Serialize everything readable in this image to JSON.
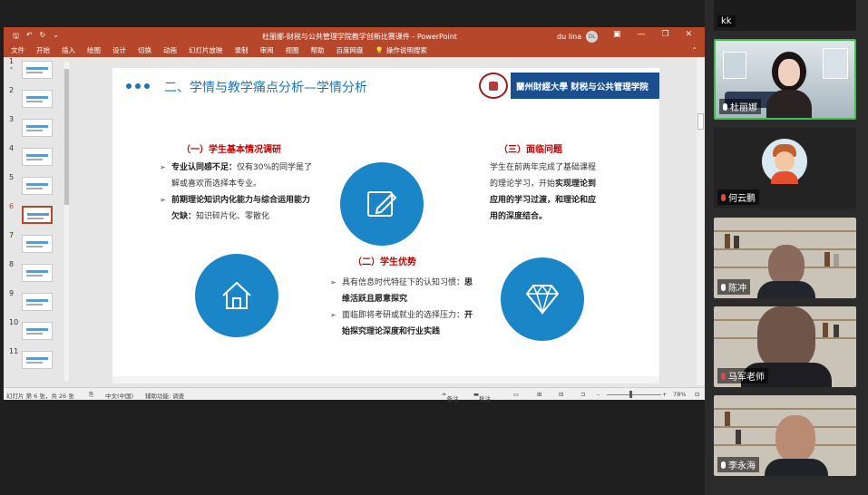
{
  "powerpoint": {
    "window_title": "杜丽娜-财税与公共管理学院教学创新比赛课件 - PowerPoint",
    "user_name": "du lina",
    "user_initials": "DL",
    "ribbon_tabs": [
      "文件",
      "开始",
      "插入",
      "绘图",
      "设计",
      "切换",
      "动画",
      "幻灯片放映",
      "录制",
      "审阅",
      "视图",
      "帮助",
      "百度网盘"
    ],
    "tell_me": "操作说明搜索",
    "thumbnails": [
      "1",
      "2",
      "3",
      "4",
      "5",
      "6",
      "7",
      "8",
      "9",
      "10",
      "11"
    ],
    "selected_slide": 6,
    "status": {
      "slide_info": "幻灯片 第 6 张，共 26 张",
      "language": "中文(中国)",
      "accessibility": "辅助功能: 调查",
      "notes": "备注",
      "comments": "批注",
      "zoom": "78%"
    }
  },
  "slide": {
    "title": "二、学情与教学痛点分析—学情分析",
    "logo_text": "蘭州財經大學 财税与公共管理学院",
    "section1": {
      "heading": "（一）学生基本情况调研",
      "b1_bold": "专业认同感不足：",
      "b1_rest": "仅有30%的同学是了解或喜欢而选择本专业。",
      "b2_bold": "前期理论知识内化能力与综合运用能力欠缺：",
      "b2_rest": "知识碎片化、零散化"
    },
    "section2": {
      "heading": "（二）学生优势",
      "b1_rest": "具有信息时代特征下的认知习惯：",
      "b1_bold": "思维活跃且愿意探究",
      "b2_rest": "面临即将考研或就业的选择压力：",
      "b2_bold": "开始探究理论深度和行业实践"
    },
    "section3": {
      "heading": "（三）面临问题",
      "text_rest": "学生在前两年完成了基础课程的理论学习，开始",
      "text_bold": "实现理论到应用的学习过渡，和理论和应用的深度结合。"
    }
  },
  "participants": [
    {
      "name": "kk"
    },
    {
      "name": "杜丽娜",
      "active": true
    },
    {
      "name": "何云鹏"
    },
    {
      "name": "陈冲"
    },
    {
      "name": "马军老师"
    },
    {
      "name": "李永海"
    }
  ]
}
